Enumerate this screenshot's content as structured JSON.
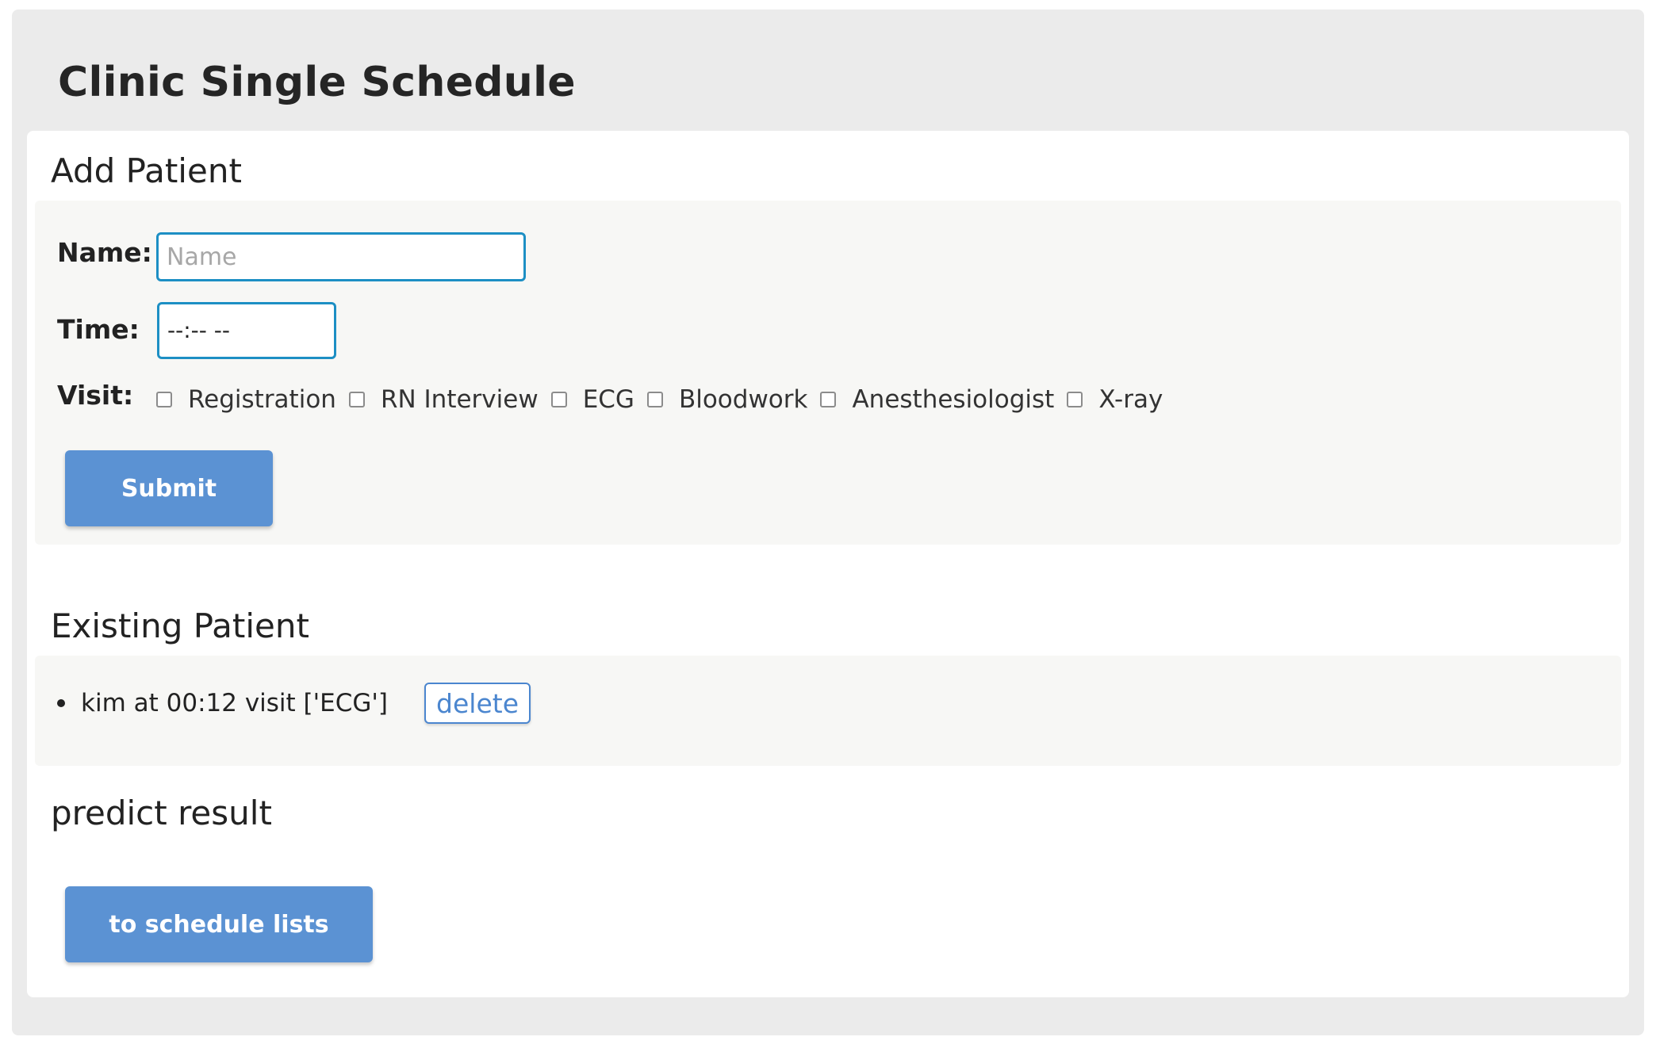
{
  "page_title": "Clinic Single Schedule",
  "add_patient": {
    "title": "Add Patient",
    "name_label": "Name:",
    "name_placeholder": "Name",
    "name_value": "",
    "time_label": "Time:",
    "time_value": "--:-- --",
    "visit_label": "Visit:",
    "visit_options": [
      {
        "label": "Registration",
        "checked": false
      },
      {
        "label": "RN Interview",
        "checked": false
      },
      {
        "label": "ECG",
        "checked": false
      },
      {
        "label": "Bloodwork",
        "checked": false
      },
      {
        "label": "Anesthesiologist",
        "checked": false
      },
      {
        "label": "X-ray",
        "checked": false
      }
    ],
    "submit_label": "Submit"
  },
  "existing_patient": {
    "title": "Existing Patient",
    "patients": [
      {
        "text": "kim at 00:12 visit ['ECG']",
        "delete_label": "delete"
      }
    ]
  },
  "predict": {
    "title": "predict result",
    "button_label": "to schedule lists"
  },
  "colors": {
    "accent": "#5b92d3",
    "input_border": "#1d8fc4",
    "link": "#4b86cf",
    "page_bg": "#ebebeb",
    "panel_bg": "#f7f7f5"
  }
}
